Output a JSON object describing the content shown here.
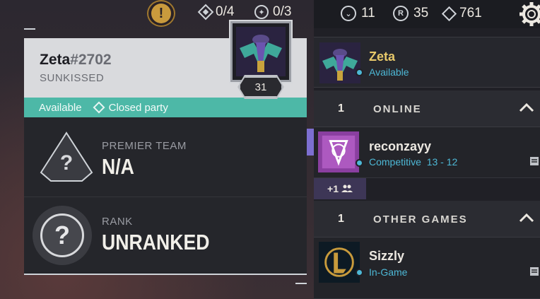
{
  "top_bar": {
    "alert_icon": "exclamation-icon",
    "missions_counter": "0/4",
    "missions_icon": "diamond-mission-icon",
    "objectives_counter": "0/3",
    "objectives_icon": "star-objective-icon"
  },
  "profile": {
    "name": "Zeta",
    "tag": "#2702",
    "title": "SUNKISSED",
    "status": "Available",
    "party_status": "Closed party",
    "level": "31",
    "premier_label": "PREMIER TEAM",
    "premier_value": "N/A",
    "rank_label": "RANK",
    "rank_value": "UNRANKED"
  },
  "currency": {
    "kingdom_credits": "11",
    "radianite": "35",
    "valorant_points": "761"
  },
  "friends_panel": {
    "self": {
      "name": "Zeta",
      "status": "Available"
    },
    "online_group": {
      "count": "1",
      "title": "ONLINE",
      "friends": [
        {
          "name": "reconzayy",
          "status": "Competitive",
          "score": "13 - 12",
          "party_extra": "+1"
        }
      ]
    },
    "other_games_group": {
      "count": "1",
      "title": "OTHER GAMES",
      "friends": [
        {
          "name": "Sizzly",
          "status": "In-Game"
        }
      ]
    }
  },
  "colors": {
    "accent_teal": "#4db8a7",
    "status_blue": "#4db8d6",
    "name_gold": "#e8c96a",
    "party_purple": "#3d3656"
  }
}
